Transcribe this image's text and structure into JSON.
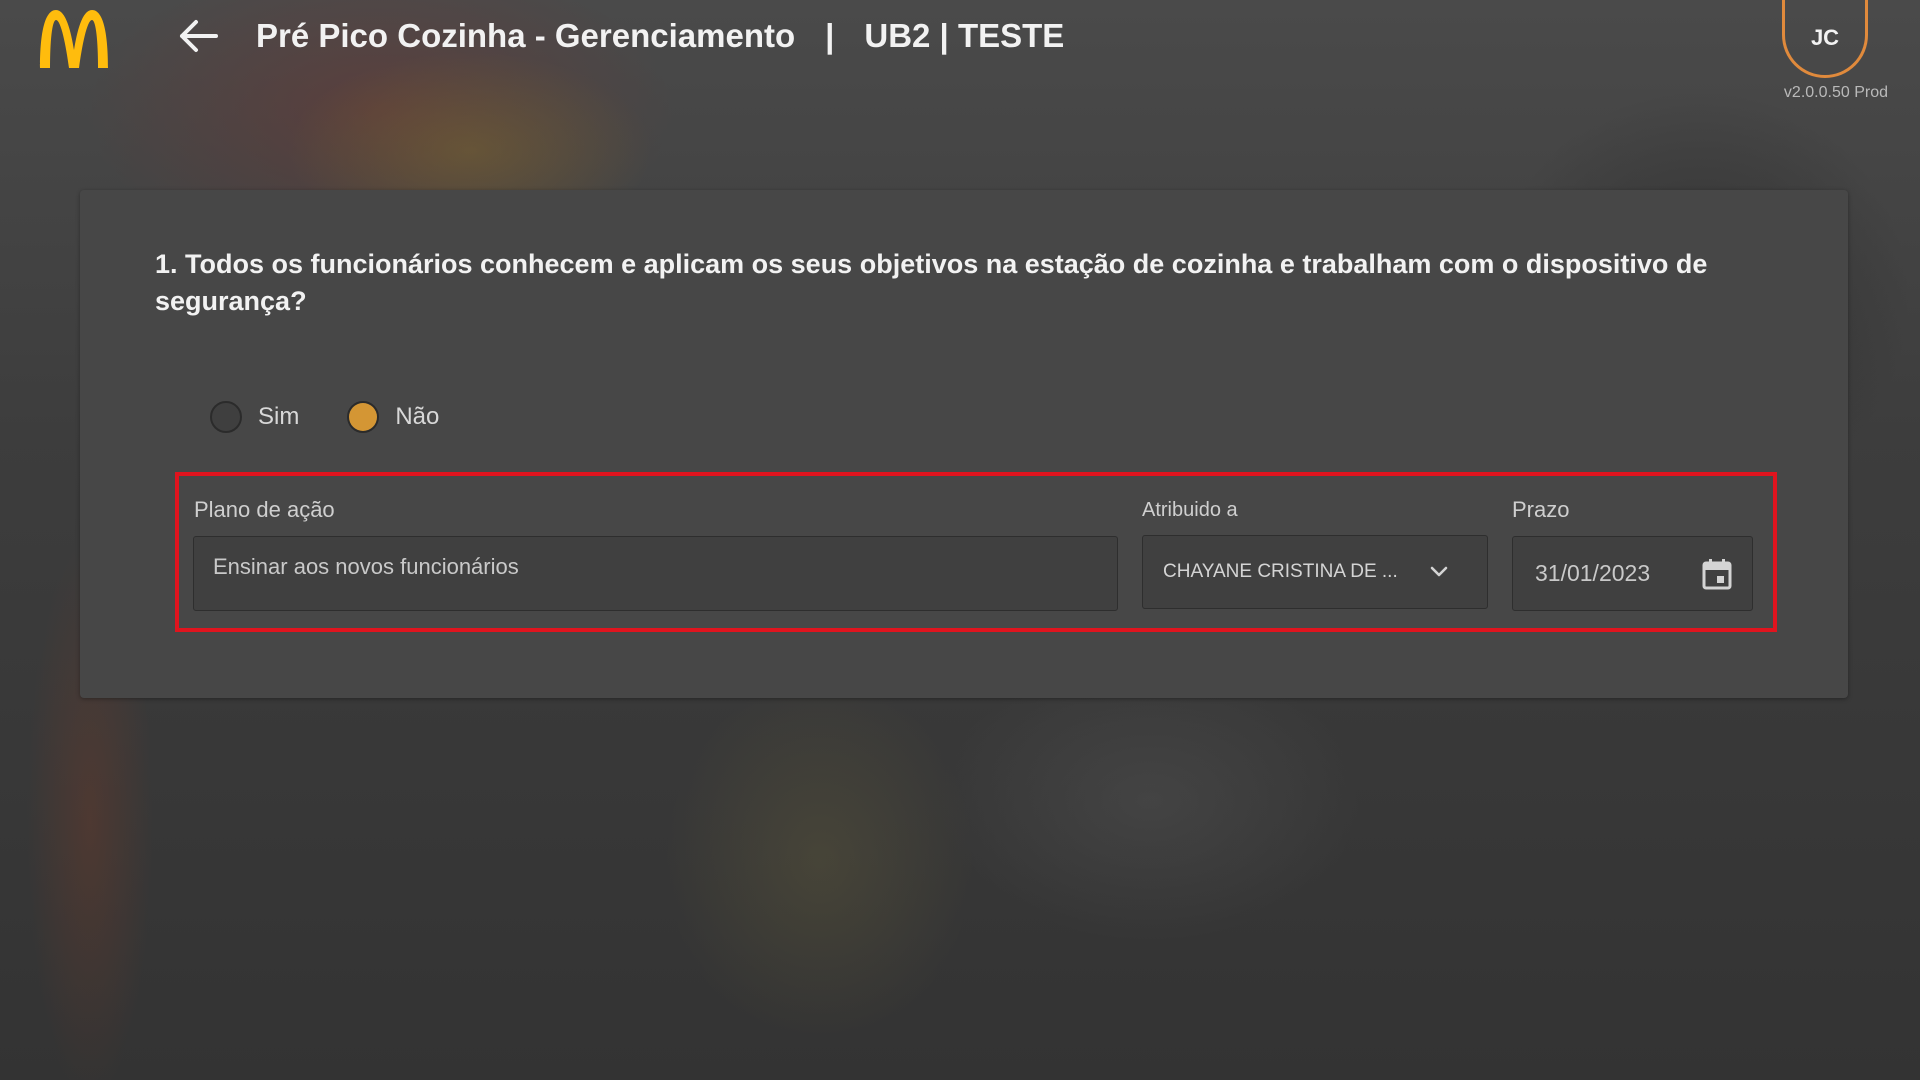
{
  "header": {
    "title": "Pré Pico Cozinha - Gerenciamento",
    "separator": "|",
    "store": "UB2 | TESTE",
    "user_initials": "JC",
    "version": "v2.0.0.50 Prod"
  },
  "colors": {
    "brand_yellow": "#FFBC0D",
    "accent_orange": "#D49634",
    "avatar_ring": "#E08A3C",
    "highlight_red": "#E0141E"
  },
  "question": {
    "text": "1. Todos os funcionários conhecem e aplicam os seus objetivos na estação de cozinha e trabalham com o dispositivo de segurança?",
    "options": [
      {
        "label": "Sim",
        "selected": false
      },
      {
        "label": "Não",
        "selected": true
      }
    ]
  },
  "action_plan": {
    "plan_label": "Plano de ação",
    "plan_value": "Ensinar aos novos funcionários",
    "assigned_label": "Atribuido a",
    "assigned_value": "CHAYANE CRISTINA DE ...",
    "deadline_label": "Prazo",
    "deadline_value": "31/01/2023"
  },
  "icons": {
    "logo": "mcdonalds-logo",
    "back": "arrow-left-icon",
    "dropdown": "chevron-down-icon",
    "calendar": "calendar-icon"
  }
}
